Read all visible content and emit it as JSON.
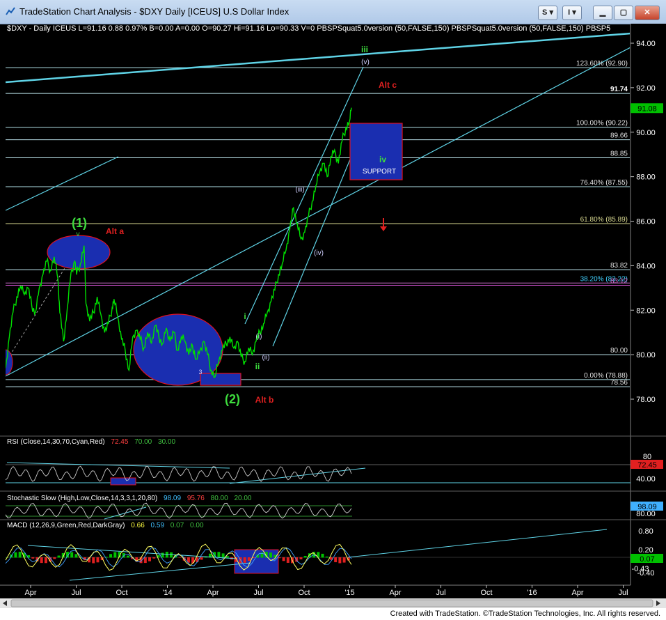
{
  "window": {
    "title": "TradeStation Chart Analysis - $DXY Daily [ICEUS] U.S Dollar Index",
    "btn_s": "S",
    "btn_i": "I",
    "footer": "Created with TradeStation. ©TradeStation Technologies, Inc. All rights reserved."
  },
  "info_line": "$DXY - Daily ICEUS L=91.16 0.88 0.97% B=0.00 A=0.00 O=90.27 Hi=91.16 Lo=90.33 V=0 PBSPSquat5.0version (50,FALSE,150) PBSPSquat5.0version (50,FALSE,150) PBSP5",
  "colors": {
    "background": "#000000",
    "price": "#00e000",
    "fib": "#b0e0e6",
    "trendline": "#5fd3e6",
    "wave_label_green": "#3ddc3d",
    "alt_label_red": "#e02020",
    "zone_blue": "#1a2eb0",
    "zone_border": "#e01020"
  },
  "chart_data": [
    {
      "type": "line",
      "name": "DXY daily price",
      "x_axis_labels": [
        "Apr",
        "Jul",
        "Oct",
        "'14",
        "Apr",
        "Jul",
        "Oct",
        "'15",
        "Apr",
        "Jul",
        "Oct",
        "'16",
        "Apr",
        "Jul"
      ],
      "y_ticks": [
        "94.00",
        "92.00",
        "90.00",
        "88.00",
        "86.00",
        "84.00",
        "82.00",
        "80.00",
        "78.00"
      ],
      "ylim": [
        77.3,
        95.1
      ],
      "series_points": [
        [
          0,
          79.4
        ],
        [
          2,
          80.8
        ],
        [
          4,
          81.9
        ],
        [
          6,
          82.6
        ],
        [
          8,
          83.1
        ],
        [
          10,
          82.7
        ],
        [
          12,
          83.0
        ],
        [
          14,
          82.2
        ],
        [
          16,
          81.9
        ],
        [
          18,
          83.0
        ],
        [
          20,
          83.6
        ],
        [
          22,
          84.2
        ],
        [
          24,
          83.8
        ],
        [
          26,
          84.4
        ],
        [
          28,
          83.4
        ],
        [
          29,
          81.9
        ],
        [
          31,
          80.6
        ],
        [
          33,
          82.1
        ],
        [
          35,
          83.7
        ],
        [
          37,
          84.2
        ],
        [
          38,
          83.6
        ],
        [
          40,
          84.1
        ],
        [
          42,
          84.9
        ],
        [
          43,
          82.3
        ],
        [
          45,
          81.5
        ],
        [
          47,
          81.9
        ],
        [
          49,
          82.6
        ],
        [
          51,
          81.8
        ],
        [
          53,
          81.0
        ],
        [
          55,
          81.4
        ],
        [
          57,
          82.1
        ],
        [
          58,
          82.5
        ],
        [
          60,
          81.7
        ],
        [
          62,
          80.7
        ],
        [
          64,
          80.2
        ],
        [
          66,
          79.3
        ],
        [
          68,
          80.8
        ],
        [
          70,
          81.1
        ],
        [
          72,
          80.7
        ],
        [
          74,
          80.3
        ],
        [
          76,
          81.0
        ],
        [
          78,
          80.5
        ],
        [
          80,
          81.3
        ],
        [
          82,
          80.8
        ],
        [
          84,
          80.5
        ],
        [
          86,
          81.2
        ],
        [
          88,
          80.6
        ],
        [
          90,
          81.0
        ],
        [
          92,
          80.2
        ],
        [
          94,
          80.8
        ],
        [
          96,
          80.6
        ],
        [
          98,
          80.0
        ],
        [
          100,
          80.4
        ],
        [
          102,
          79.8
        ],
        [
          104,
          80.2
        ],
        [
          106,
          80.6
        ],
        [
          108,
          80.0
        ],
        [
          110,
          79.3
        ],
        [
          112,
          79.0
        ],
        [
          114,
          79.7
        ],
        [
          116,
          80.2
        ],
        [
          118,
          80.5
        ],
        [
          120,
          80.8
        ],
        [
          122,
          80.3
        ],
        [
          124,
          80.6
        ],
        [
          126,
          79.9
        ],
        [
          128,
          79.7
        ],
        [
          130,
          80.3
        ],
        [
          132,
          80.0
        ],
        [
          134,
          80.6
        ],
        [
          136,
          81.0
        ],
        [
          138,
          81.4
        ],
        [
          140,
          81.9
        ],
        [
          142,
          82.4
        ],
        [
          144,
          82.9
        ],
        [
          146,
          83.6
        ],
        [
          148,
          84.1
        ],
        [
          150,
          84.7
        ],
        [
          152,
          85.6
        ],
        [
          154,
          86.6
        ],
        [
          156,
          85.9
        ],
        [
          158,
          85.2
        ],
        [
          160,
          85.5
        ],
        [
          162,
          86.2
        ],
        [
          164,
          86.9
        ],
        [
          166,
          87.6
        ],
        [
          168,
          88.2
        ],
        [
          170,
          88.6
        ],
        [
          172,
          88.0
        ],
        [
          174,
          88.9
        ],
        [
          176,
          89.2
        ],
        [
          178,
          88.6
        ],
        [
          180,
          89.6
        ],
        [
          182,
          90.2
        ],
        [
          184,
          90.5
        ],
        [
          185,
          91.1
        ]
      ],
      "fib_levels": [
        {
          "label": "123.60% (92.90)",
          "value": 92.9
        },
        {
          "label": "100.00% (90.22)",
          "value": 90.22
        },
        {
          "label": "76.40% (87.55)",
          "value": 87.55
        },
        {
          "label": "61.80% (85.89)",
          "value": 85.89
        },
        {
          "label": "38.20% (83.22)",
          "value": 83.22
        },
        {
          "label": "0.00% (78.88)",
          "value": 78.88
        }
      ],
      "price_lines": [
        {
          "label": "91.74",
          "value": 91.74
        },
        {
          "label": "89.66",
          "value": 89.66
        },
        {
          "label": "88.85",
          "value": 88.85
        },
        {
          "label": "83.82",
          "value": 83.82
        },
        {
          "label": "83.12",
          "value": 83.12
        },
        {
          "label": "80.00",
          "value": 80.0
        },
        {
          "label": "78.56",
          "value": 78.56
        }
      ],
      "last_value": "91.08",
      "wave_labels": [
        {
          "text": "(1)",
          "color": "green"
        },
        {
          "text": "v",
          "color": "green"
        },
        {
          "text": "(2)",
          "color": "green"
        },
        {
          "text": "i",
          "color": "green"
        },
        {
          "text": "ii",
          "color": "green"
        },
        {
          "text": "iii",
          "color": "green"
        },
        {
          "text": "iv",
          "color": "green"
        },
        {
          "text": "(i)",
          "color": "white"
        },
        {
          "text": "(ii)",
          "color": "white"
        },
        {
          "text": "(iii)",
          "color": "white"
        },
        {
          "text": "(iv)",
          "color": "white"
        },
        {
          "text": "(v)",
          "color": "white"
        },
        {
          "text": "3",
          "color": "white"
        },
        {
          "text": "Alt a",
          "color": "red"
        },
        {
          "text": "Alt b",
          "color": "red"
        },
        {
          "text": "Alt  c",
          "color": "red"
        }
      ],
      "support_label": "SUPPORT"
    },
    {
      "type": "line",
      "name": "RSI",
      "legend": {
        "name": "RSI (Close,14,30,70,Cyan,Red)",
        "v1": "72.45",
        "v2": "70.00",
        "v3": "30.00"
      },
      "y_ticks": [
        "80",
        "40.00"
      ],
      "last_value": "72.45",
      "ylim": [
        20,
        100
      ]
    },
    {
      "type": "line",
      "name": "Stochastic Slow",
      "legend": {
        "name": "Stochastic Slow (High,Low,Close,14,3,3,1,20,80)",
        "v1": "98.09",
        "v2": "95.76",
        "v3": "80.00",
        "v4": "20.00"
      },
      "y_ticks": [
        "80.00"
      ],
      "last_value": "98.09",
      "ylim": [
        0,
        100
      ]
    },
    {
      "type": "bar",
      "name": "MACD",
      "legend": {
        "name": "MACD (12,26,9,Green,Red,DarkGray)",
        "v1": "0.66",
        "v2": "0.59",
        "v3": "0.07",
        "v4": "0.00"
      },
      "y_ticks": [
        "0.80",
        "0.20",
        "-0.43",
        "-0.40"
      ],
      "last_value": "0.07",
      "ylim": [
        -0.6,
        0.9
      ]
    }
  ]
}
